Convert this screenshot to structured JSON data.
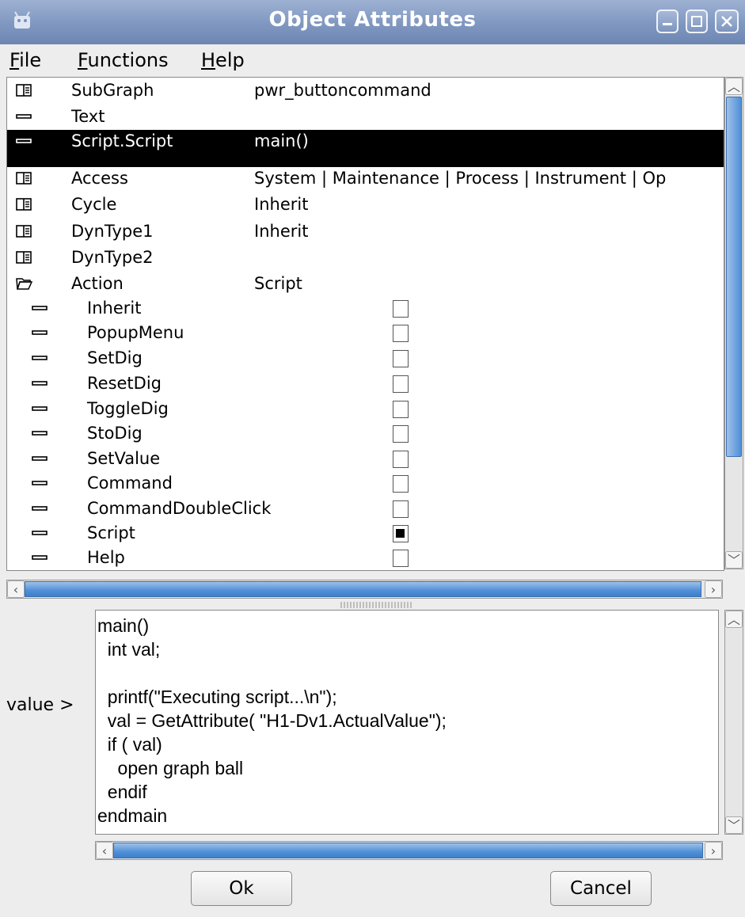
{
  "window": {
    "title": "Object Attributes"
  },
  "menu": {
    "file": "File",
    "functions": "Functions",
    "help": "Help"
  },
  "tree": {
    "rows": [
      {
        "name": "SubGraph",
        "value": "pwr_buttoncommand"
      },
      {
        "name": "Text",
        "value": ""
      },
      {
        "name": "Script.Script",
        "value": "main()"
      },
      {
        "name": "Access",
        "value": "System | Maintenance | Process | Instrument | Op"
      },
      {
        "name": "Cycle",
        "value": "Inherit"
      },
      {
        "name": "DynType1",
        "value": "Inherit"
      },
      {
        "name": "DynType2",
        "value": ""
      },
      {
        "name": "Action",
        "value": "Script"
      },
      {
        "name": "Inherit",
        "checked": false
      },
      {
        "name": "PopupMenu",
        "checked": false
      },
      {
        "name": "SetDig",
        "checked": false
      },
      {
        "name": "ResetDig",
        "checked": false
      },
      {
        "name": "ToggleDig",
        "checked": false
      },
      {
        "name": "StoDig",
        "checked": false
      },
      {
        "name": "SetValue",
        "checked": false
      },
      {
        "name": "Command",
        "checked": false
      },
      {
        "name": "CommandDoubleClick",
        "checked": false
      },
      {
        "name": "Script",
        "checked": true
      },
      {
        "name": "Help",
        "checked": false
      }
    ]
  },
  "editor": {
    "label": "value >",
    "text": "main()\n  int val;\n\n  printf(\"Executing script...\\n\");\n  val = GetAttribute( \"H1-Dv1.ActualValue\");\n  if ( val)\n    open graph ball\n  endif\nendmain"
  },
  "buttons": {
    "ok": "Ok",
    "cancel": "Cancel"
  }
}
